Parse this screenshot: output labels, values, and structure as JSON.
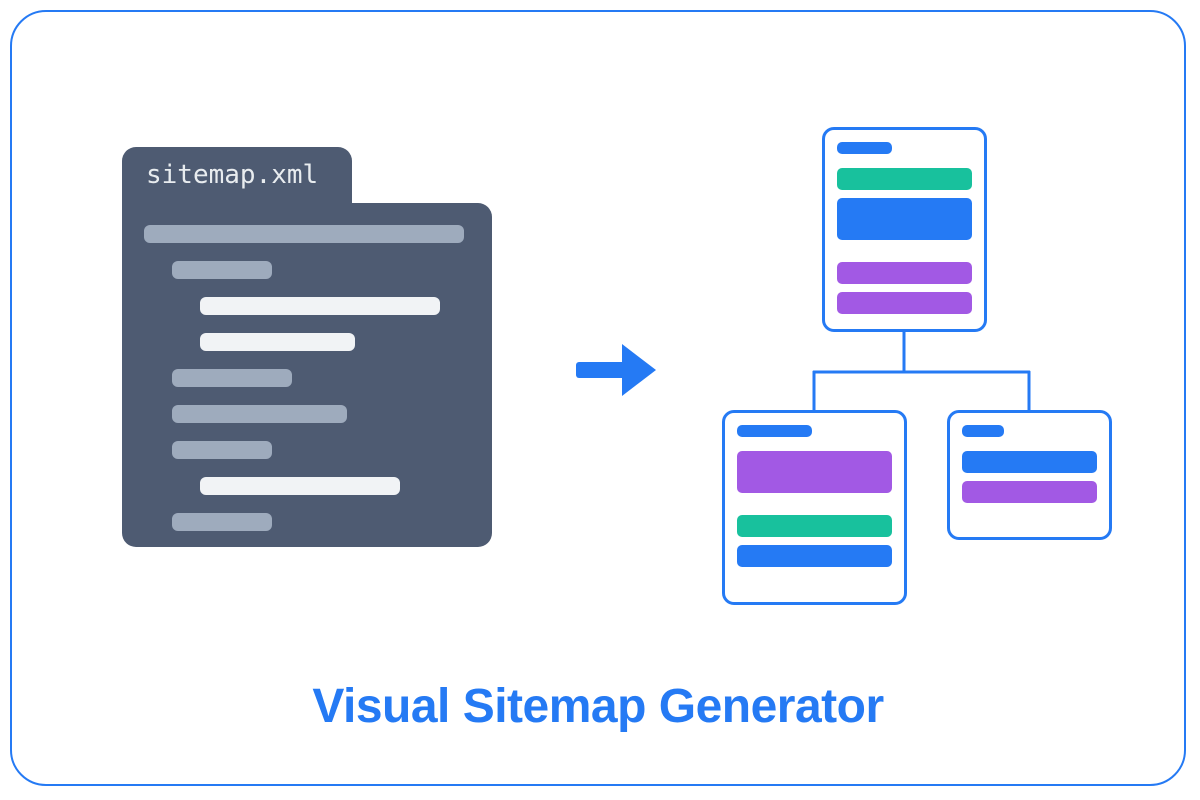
{
  "title": "Visual Sitemap Generator",
  "file": {
    "name": "sitemap.xml"
  },
  "colors": {
    "accent": "#257af4",
    "file_bg": "#4e5b72",
    "file_line_light": "#9eabbd",
    "file_line_white": "#f1f3f5",
    "teal": "#18c19d",
    "purple": "#a259e4"
  },
  "sitemap": {
    "root": {
      "bars": [
        "blue",
        "teal",
        "blue",
        "purple",
        "purple"
      ]
    },
    "children": [
      {
        "id": "a",
        "bars": [
          "blue",
          "purple",
          "teal",
          "blue"
        ]
      },
      {
        "id": "b",
        "bars": [
          "blue",
          "blue",
          "purple"
        ]
      }
    ]
  }
}
